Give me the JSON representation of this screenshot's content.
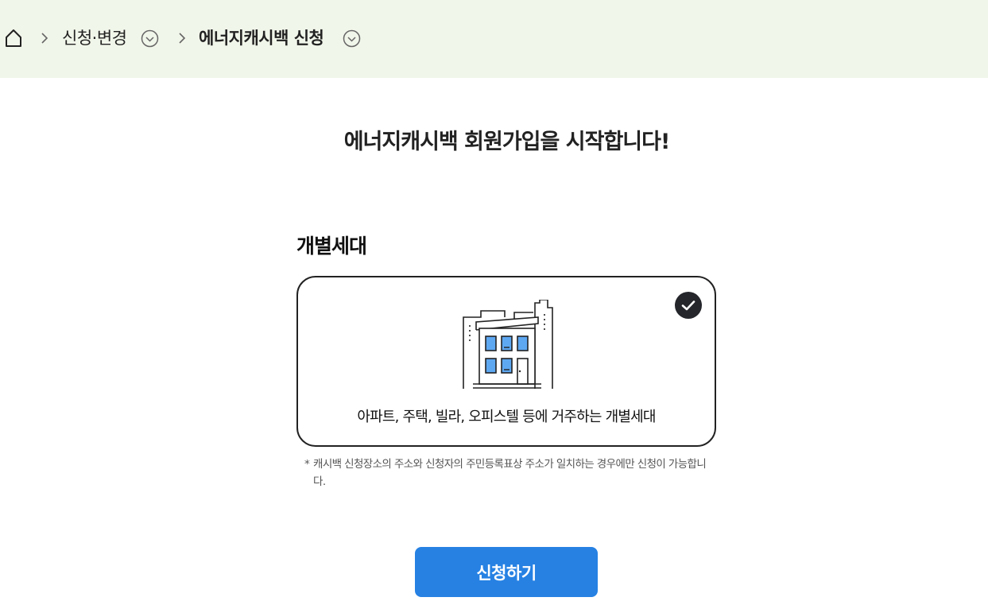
{
  "breadcrumb": {
    "home_icon": "home-icon",
    "items": [
      {
        "label": "신청·변경"
      },
      {
        "label": "에너지캐시백 신청"
      }
    ]
  },
  "main": {
    "title": "에너지캐시백 회원가입을 시작합니다!",
    "section_label": "개별세대",
    "card": {
      "icon": "building-icon",
      "selected": true,
      "description": "아파트, 주택, 빌라, 오피스텔 등에 거주하는 개별세대"
    },
    "note_star": "*",
    "note": "캐시백 신청장소의 주소와 신청자의 주민등록표상 주소가 일치하는 경우에만 신청이 가능합니다.",
    "submit_label": "신청하기"
  },
  "colors": {
    "breadcrumb_bg": "#f1f6ea",
    "primary": "#2681e3",
    "check_bg": "#24262b",
    "window_blue": "#5ea8f2"
  }
}
